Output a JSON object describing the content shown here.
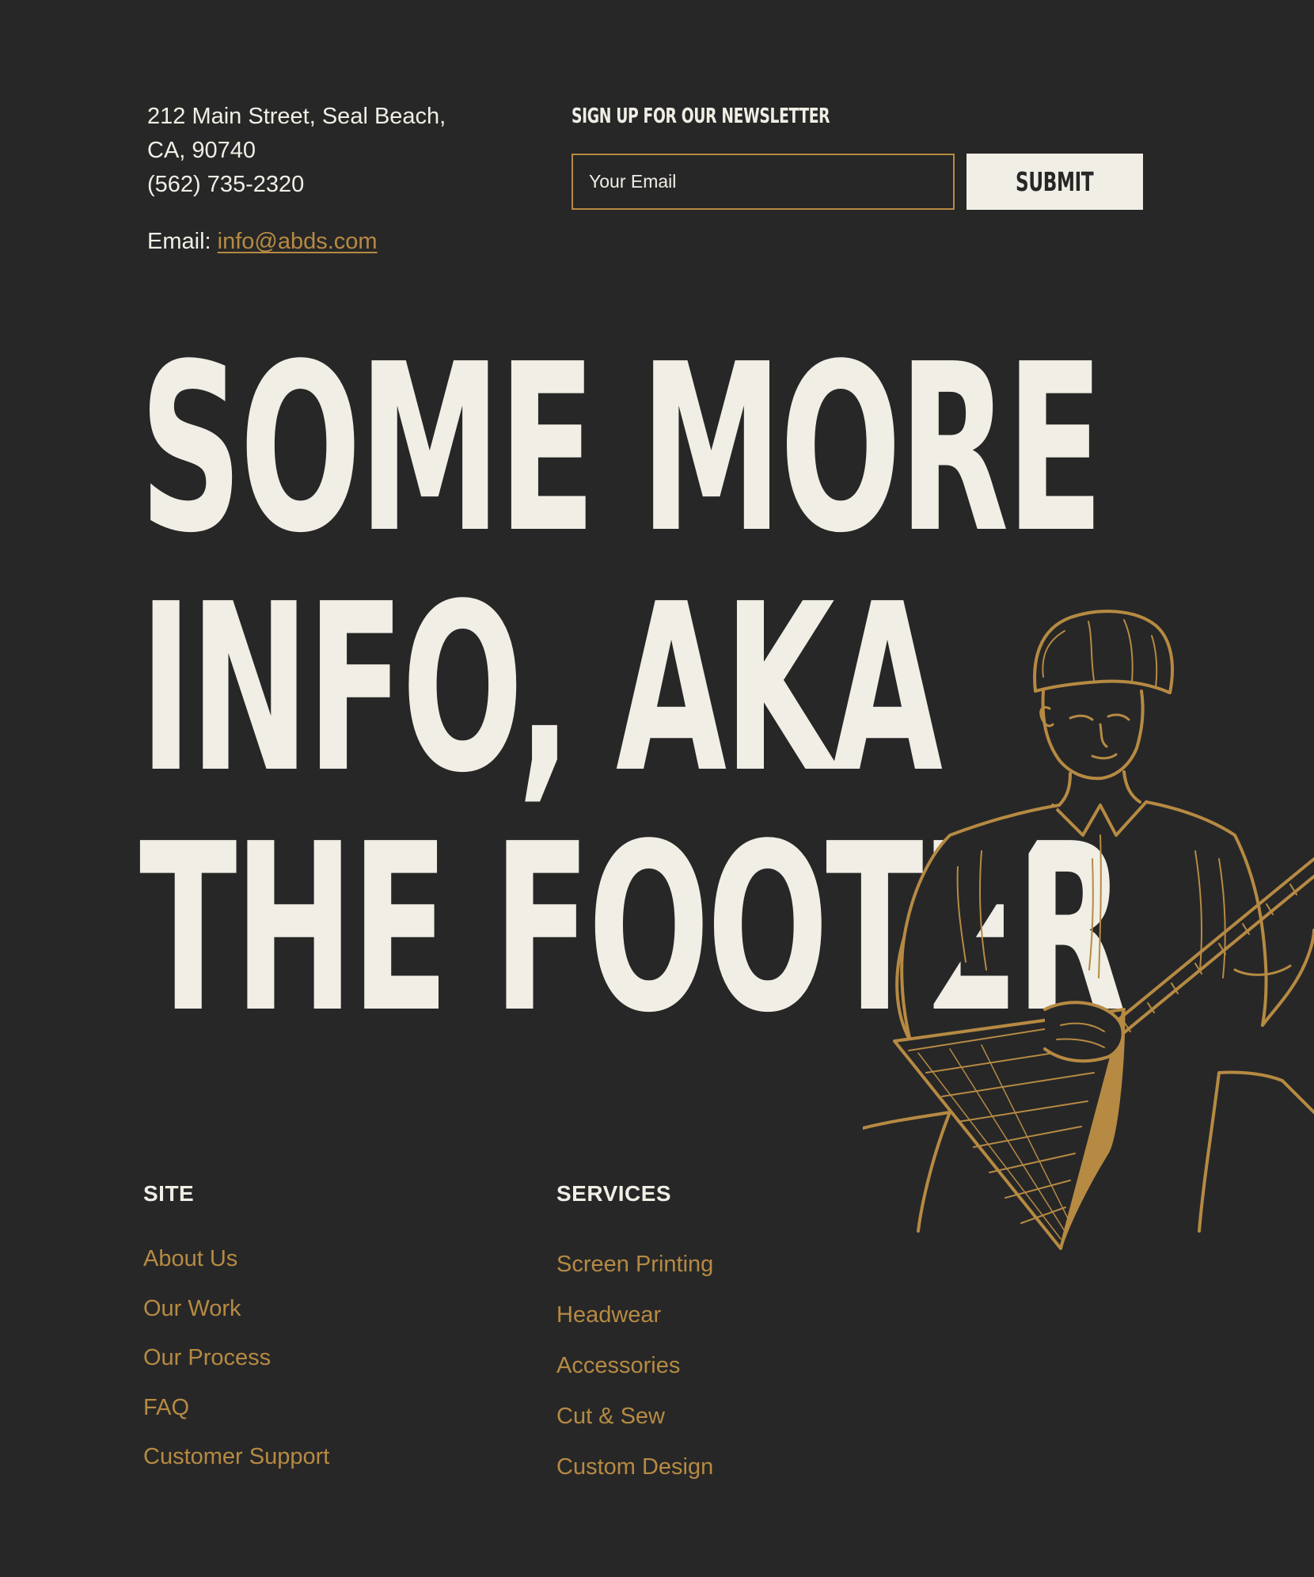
{
  "contact": {
    "address_line1": "212 Main Street, Seal Beach,",
    "address_line2": "CA, 90740",
    "phone": "(562) 735-2320",
    "email_label": "Email:",
    "email_link": "info@abds.com"
  },
  "newsletter": {
    "title": "SIGN UP FOR OUR NEWSLETTER",
    "input_placeholder": "Your Email",
    "submit_label": "SUBMIT"
  },
  "headline": {
    "line1": "SOME MORE",
    "line2": "INFO, AKA",
    "line3": "THE FOOTER"
  },
  "site": {
    "heading": "SITE",
    "links": [
      "About Us",
      "Our Work",
      "Our Process",
      "FAQ",
      "Customer Support"
    ]
  },
  "services": {
    "heading": "SERVICES",
    "links": [
      "Screen Printing",
      "Headwear",
      "Accessories",
      "Cut & Sew",
      "Custom Design"
    ]
  },
  "colors": {
    "background": "#272727",
    "text": "#f0eee5",
    "accent": "#b68a43"
  },
  "illustration": {
    "icon": "balalaika-player-illustration"
  }
}
